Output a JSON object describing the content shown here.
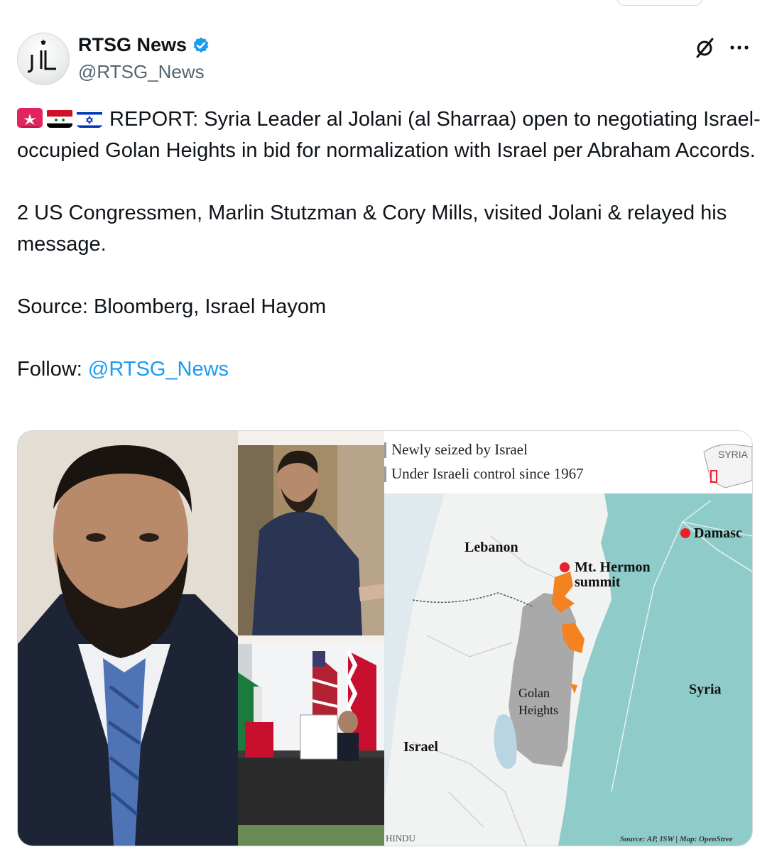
{
  "account": {
    "display_name": "RTSG News",
    "handle": "@RTSG_News",
    "verified": true,
    "avatar_text": "JIL"
  },
  "tweet": {
    "flags": [
      "rotating-light-emoji",
      "syria-flag-emoji",
      "israel-flag-emoji"
    ],
    "paragraph1": "REPORT: Syria Leader al Jolani (al Sharraa) open to negotiating Israel-occupied Golan Heights in bid for normalization with Israel per Abraham Accords.",
    "paragraph2": "2 US Congressmen, Marlin Stutzman & Cory Mills, visited Jolani & relayed his message.",
    "paragraph3": "Source: Bloomberg, Israel Hayom",
    "follow_label": "Follow: ",
    "follow_handle": "@RTSG_News"
  },
  "map": {
    "legend_new": "Newly seized by Israel",
    "legend_old": "Under Israeli control since 1967",
    "inset_label": "SYRIA",
    "lebanon": "Lebanon",
    "hermon_1": "Mt. Hermon",
    "hermon_2": "summit",
    "damascus": "Damasc",
    "golan_1": "Golan",
    "golan_2": "Heights",
    "syria": "Syria",
    "israel": "Israel",
    "credit_left": "HINDU",
    "credit_right": "Source: AP, ISW | Map: OpenStree"
  },
  "colors": {
    "link": "#1d9bf0",
    "verified": "#1d9bf0",
    "syria_region": "#8fcbc8",
    "seized": "#f58220",
    "occupied": "#a9a9a9"
  }
}
